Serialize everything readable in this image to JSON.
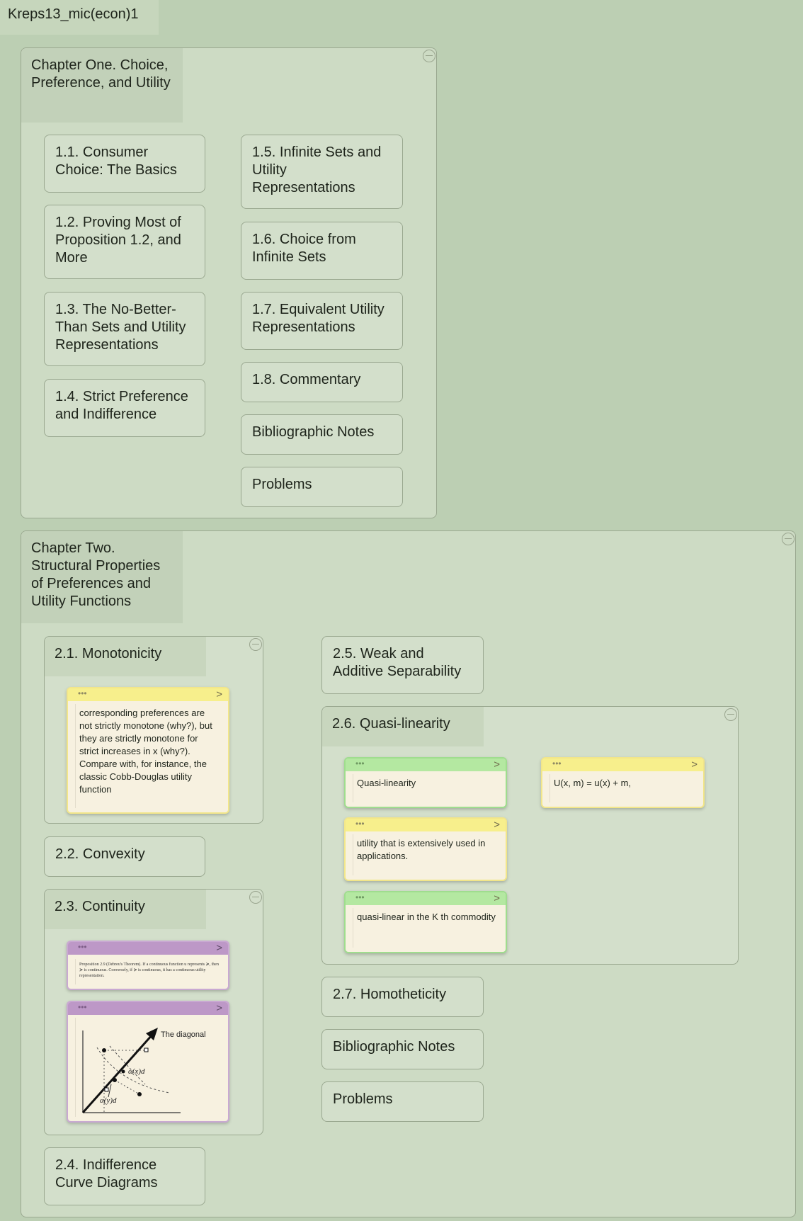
{
  "document": {
    "title": "Kreps13_mic(econ)1"
  },
  "chapter1": {
    "title": "Chapter One. Choice, Preference, and Utility",
    "sections": [
      "1.1. Consumer Choice: The Basics",
      "1.2. Proving Most of Proposition 1.2, and More",
      "1.3. The No-Better-Than Sets and Utility Representations",
      "1.4. Strict Preference and Indifference",
      "1.5. Infinite Sets and Utility Representations",
      "1.6. Choice from Infinite Sets",
      "1.7. Equivalent Utility Representations",
      "1.8. Commentary",
      "Bibliographic Notes",
      "Problems"
    ]
  },
  "chapter2": {
    "title": "Chapter Two. Structural Properties of Preferences and Utility Functions",
    "s21": {
      "title": "2.1. Monotonicity",
      "note": "corresponding preferences are not strictly monotone (why?), but they are strictly monotone for strict increases in x (why?). Compare with, for instance, the classic Cobb-Douglas utility function"
    },
    "s22": {
      "title": "2.2. Convexity"
    },
    "s23": {
      "title": "2.3. Continuity",
      "excerpt": "Proposition 2.9 (Debreu's Theorem). If a continuous function u represents ≽, then ≽ is continuous. Conversely, if ≽ is continuous, it has a continuous utility representation.",
      "figure": {
        "label_diagonal": "The diagonal",
        "label_ax": "α(x)d",
        "label_ay": "α(y)d"
      }
    },
    "s24": {
      "title": "2.4. Indifference Curve Diagrams"
    },
    "s25": {
      "title": "2.5. Weak and Additive Separability"
    },
    "s26": {
      "title": "2.6. Quasi-linearity",
      "notes": [
        "Quasi-linearity",
        "U(x, m) = u(x) + m,",
        "utility that is extensively used in applications.",
        "quasi-linear in the K th commodity"
      ]
    },
    "s27": {
      "title": "2.7. Homotheticity"
    },
    "biblio": "Bibliographic Notes",
    "problems": "Problems"
  },
  "icons": {
    "card_dots": "•••",
    "card_chevron": ">"
  },
  "colors": {
    "background": "#bccfb3",
    "card_yellow": "#f7ef8c",
    "card_green": "#b4e8a1",
    "card_purple": "#bd98c7"
  }
}
